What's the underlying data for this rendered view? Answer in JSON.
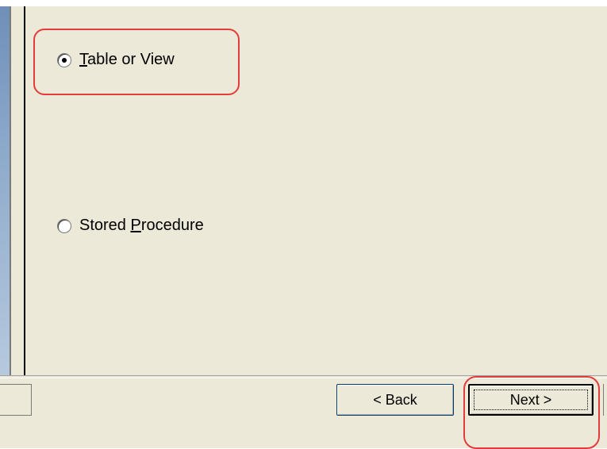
{
  "options": {
    "table_or_view": {
      "prefix": "",
      "accel": "T",
      "rest": "able or View",
      "checked": true
    },
    "stored_procedure": {
      "prefix": "Stored ",
      "accel": "P",
      "rest": "rocedure",
      "checked": false
    }
  },
  "buttons": {
    "back": "< Back",
    "next": "Next >"
  },
  "colors": {
    "dialog_bg": "#ece9d8",
    "highlight": "#e53b3b"
  }
}
